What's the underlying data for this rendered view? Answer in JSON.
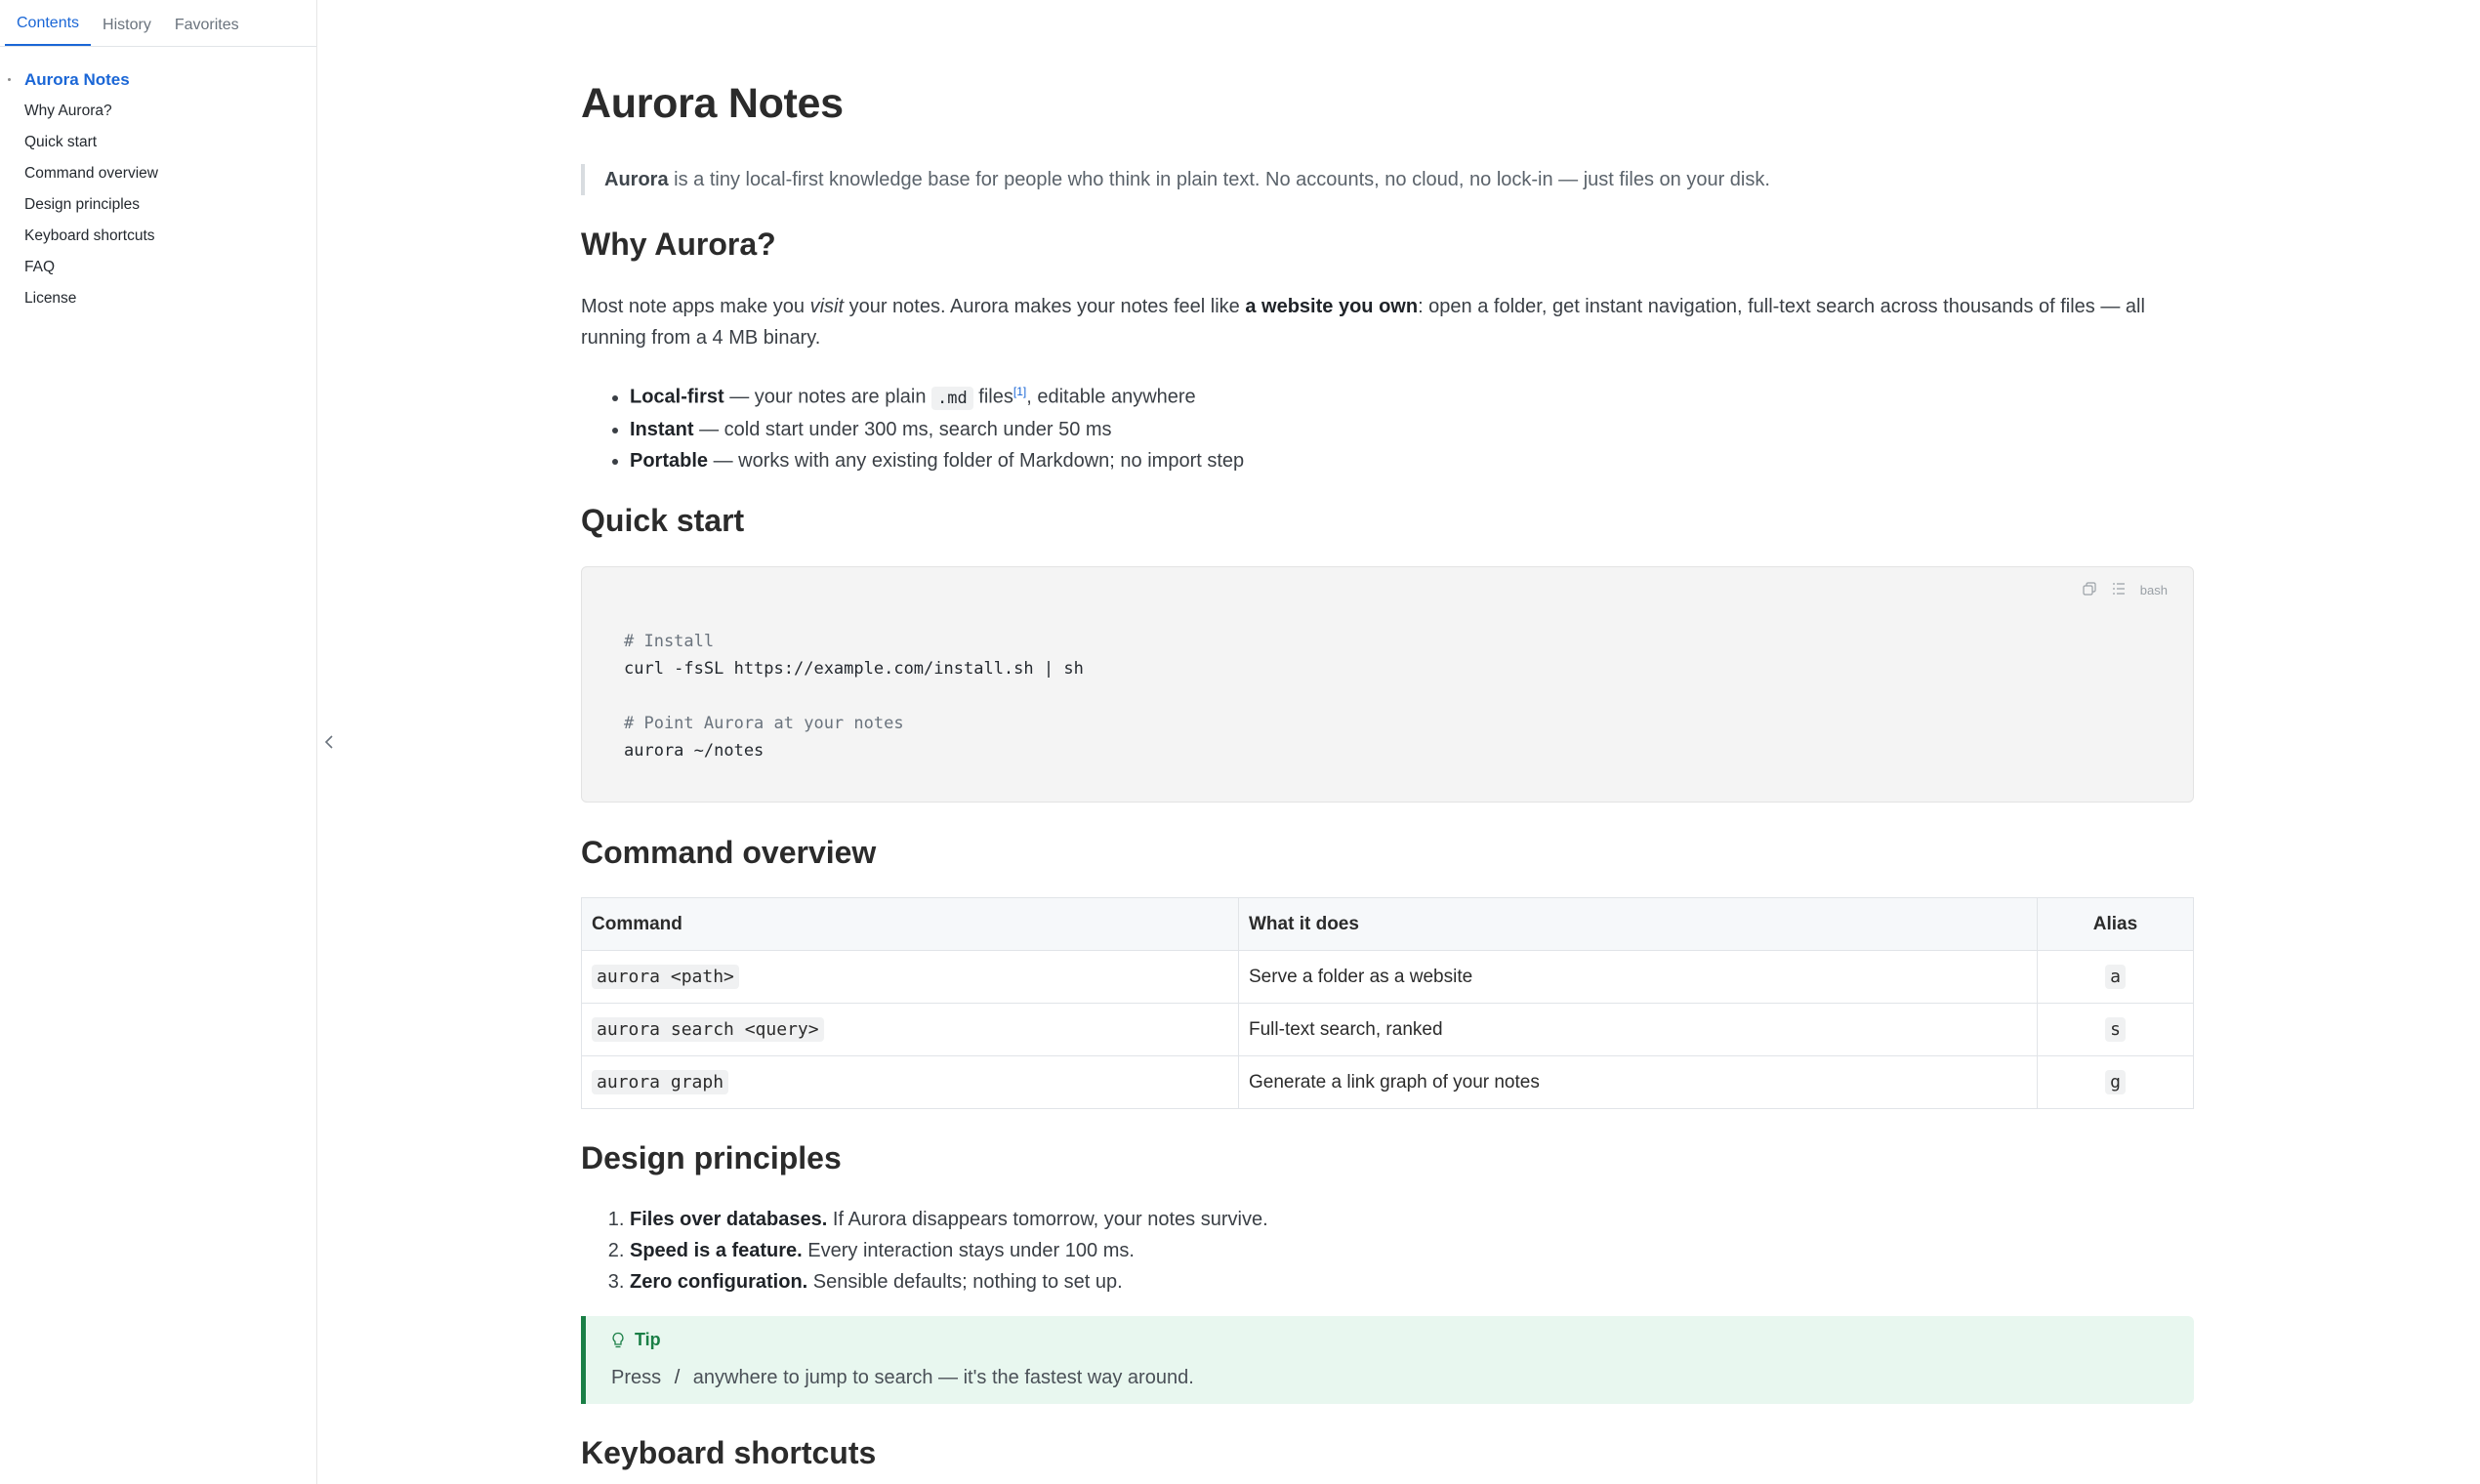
{
  "sidebar": {
    "tabs": [
      "Contents",
      "History",
      "Favorites"
    ],
    "toc": [
      "Aurora Notes",
      "Why Aurora?",
      "Quick start",
      "Command overview",
      "Design principles",
      "Keyboard shortcuts",
      "FAQ",
      "License"
    ]
  },
  "page": {
    "title": "Aurora Notes",
    "lead_strong": "Aurora",
    "lead_rest": " is a tiny local-first knowledge base for people who think in plain text. No accounts, no cloud, no lock-in — just files on your disk."
  },
  "why": {
    "heading": "Why Aurora?",
    "p1": "Most note apps make you ",
    "p1_em": "visit",
    "p2": " your notes. Aurora makes your notes feel like ",
    "p2_strong": "a website you own",
    "p3": ": open a folder, get instant navigation, full-text search across thousands of files — all running from a 4 MB binary.",
    "bullets": [
      {
        "strong": "Local-first",
        "pre": " — your notes are plain ",
        "code": ".md",
        "post": " files",
        "sup": "[1]",
        "tail": ", editable anywhere"
      },
      {
        "strong": "Instant",
        "text": " — cold start under 300 ms, search under 50 ms"
      },
      {
        "strong": "Portable",
        "text": " — works with any existing folder of Markdown; no import step"
      }
    ]
  },
  "quickstart": {
    "heading": "Quick start",
    "lang": "bash",
    "lines": [
      "# Install",
      "curl -fsSL https://example.com/install.sh | sh",
      "",
      "# Point Aurora at your notes",
      "aurora ~/notes"
    ]
  },
  "commands": {
    "heading": "Command overview",
    "headers": [
      "Command",
      "What it does",
      "Alias"
    ],
    "rows": [
      [
        "aurora <path>",
        "Serve a folder as a website",
        "a"
      ],
      [
        "aurora search <query>",
        "Full-text search, ranked",
        "s"
      ],
      [
        "aurora graph",
        "Generate a link graph of your notes",
        "g"
      ]
    ]
  },
  "principles": {
    "heading": "Design principles",
    "items": [
      {
        "strong": "Files over databases.",
        "text": " If Aurora disappears tomorrow, your notes survive."
      },
      {
        "strong": "Speed is a feature.",
        "text": " Every interaction stays under 100 ms."
      },
      {
        "strong": "Zero configuration.",
        "text": " Sensible defaults; nothing to set up."
      }
    ]
  },
  "tip": {
    "title": "Tip",
    "pre": "Press ",
    "key": "/",
    "post": " anywhere to jump to search — it's the fastest way around."
  },
  "shortcuts": {
    "heading": "Keyboard shortcuts"
  },
  "colors": {
    "accent": "#1a66d6",
    "tip_green": "#1a7f46",
    "tip_bg": "#e8f7ef"
  }
}
